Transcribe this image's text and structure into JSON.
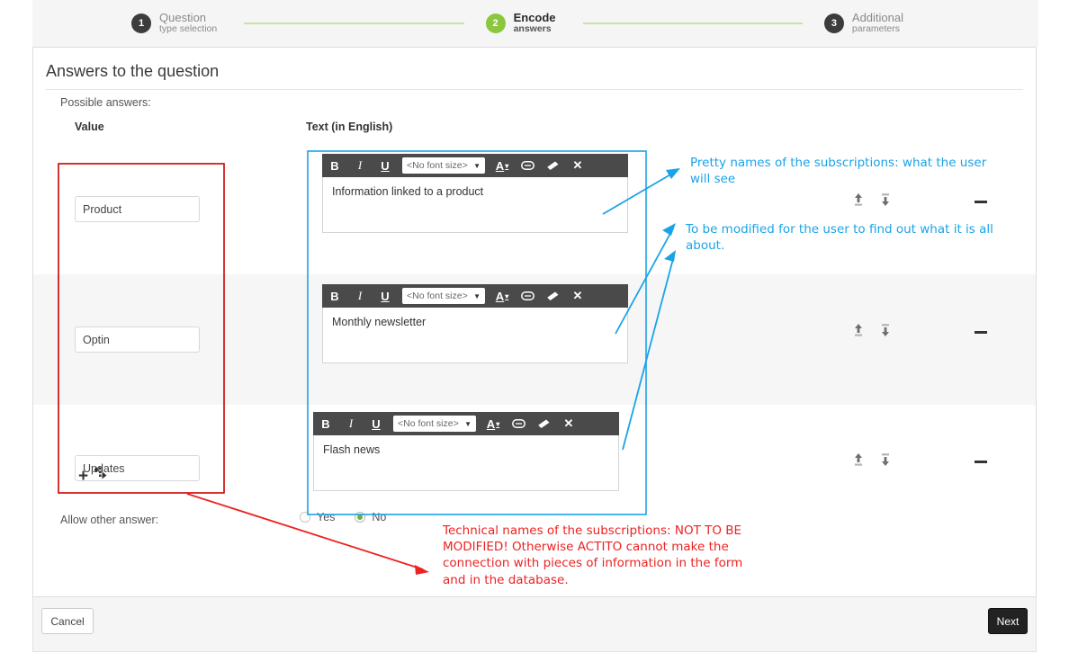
{
  "wizard": {
    "steps": [
      {
        "num": "1",
        "title": "Question",
        "sub": "type selection",
        "state": "done"
      },
      {
        "num": "2",
        "title": "Encode",
        "sub": "answers",
        "state": "active"
      },
      {
        "num": "3",
        "title": "Additional",
        "sub": "parameters",
        "state": "todo"
      }
    ]
  },
  "panel": {
    "title": "Answers to the question",
    "possible_answers_label": "Possible answers:",
    "columns": {
      "value": "Value",
      "text": "Text (in English)"
    },
    "rows": [
      {
        "value": "Product",
        "editor": {
          "bold": "B",
          "italic": "I",
          "underline": "U",
          "font_size": "<No font size>",
          "caret": "▼",
          "color_label": "A",
          "color_caret": "▾",
          "link_icon": "link-icon",
          "eraser_icon": "eraser-icon",
          "close_label": "✕"
        },
        "body": "Information linked to a product",
        "actions": {
          "move_top": "move-to-top-icon",
          "move_bottom": "move-to-bottom-icon",
          "remove": "remove-row-icon"
        }
      },
      {
        "value": "Optin",
        "editor": {
          "bold": "B",
          "italic": "I",
          "underline": "U",
          "font_size": "<No font size>",
          "caret": "▼",
          "color_label": "A",
          "color_caret": "▾",
          "link_icon": "link-icon",
          "eraser_icon": "eraser-icon",
          "close_label": "✕"
        },
        "body": "Monthly newsletter",
        "actions": {
          "move_top": "move-to-top-icon",
          "move_bottom": "move-to-bottom-icon",
          "remove": "remove-row-icon"
        }
      },
      {
        "value": "Updates",
        "editor": {
          "bold": "B",
          "italic": "I",
          "underline": "U",
          "font_size": "<No font size>",
          "caret": "▼",
          "color_label": "A",
          "color_caret": "▾",
          "link_icon": "link-icon",
          "eraser_icon": "eraser-icon",
          "close_label": "✕"
        },
        "body": "Flash news",
        "actions": {
          "move_top": "move-to-top-icon",
          "move_bottom": "move-to-bottom-icon",
          "remove": "remove-row-icon"
        }
      }
    ],
    "add_row": {
      "plus": "+",
      "icon": "add-multiple-icon"
    },
    "allow_other": {
      "label": "Allow other answer:",
      "yes": "Yes",
      "no": "No",
      "selected": "No"
    }
  },
  "footer": {
    "cancel": "Cancel",
    "next": "Next"
  },
  "annotations": {
    "blue_1": "Pretty names of the subscriptions: what the user will see",
    "blue_2": "To be modified for the user to find out what it is all about.",
    "red_1": "Technical names of the subscriptions: NOT TO BE MODIFIED! Otherwise ACTITO cannot make the connection with pieces of information in the form and in the database."
  },
  "colors": {
    "accent_green": "#8cc63e",
    "annotation_blue": "#1aa3e8",
    "annotation_red": "#ee2222",
    "toolbar_dark": "#4a4a4a",
    "next_button": "#222222"
  }
}
